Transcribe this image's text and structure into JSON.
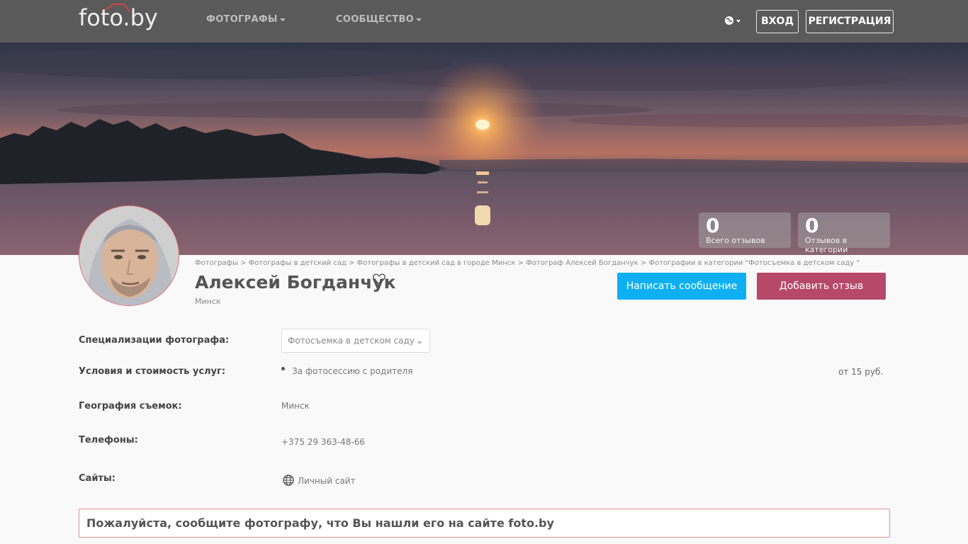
{
  "header": {
    "logo": "foto.by",
    "nav": [
      "ФОТОГРАФЫ",
      "СООБЩЕСТВО"
    ],
    "login": "ВХОД",
    "register": "РЕГИСТРАЦИЯ"
  },
  "stats": [
    {
      "value": "0",
      "label": "Всего отзывов"
    },
    {
      "value": "0",
      "label": "Отзывов в категории"
    }
  ],
  "profile": {
    "breadcrumb": "Фотографы > Фотографы в детский сад > Фотографы в детский сад в городе Минск > Фотограф Алексей Богданчук > Фотографии в категории \"Фотосъемка в детском саду \"",
    "name": "Алексей Богданчук",
    "city": "Минск",
    "write_message": "Написать сообщение",
    "add_review": "Добавить отзыв"
  },
  "details": {
    "specialization_label": "Специализации фотографа:",
    "specialization_value": "Фотосъемка в детском саду",
    "conditions_label": "Условия и стоимость услуг:",
    "conditions_item": "За фотосессию с родителя",
    "conditions_price": "от 15 руб.",
    "geography_label": "География съемок:",
    "geography_value": "Минск",
    "phones_label": "Телефоны:",
    "phones_value": "+375 29 363-48-66",
    "sites_label": "Сайты:",
    "sites_value": "Личный сайт"
  },
  "notice": "Пожалуйста, сообщите фотографу, что Вы нашли его на сайте foto.by",
  "colors": {
    "topbar": "#5a5a5a",
    "message_button": "#0fb0f3",
    "review_button": "#b6496a",
    "notice_border": "#e58e8e"
  }
}
